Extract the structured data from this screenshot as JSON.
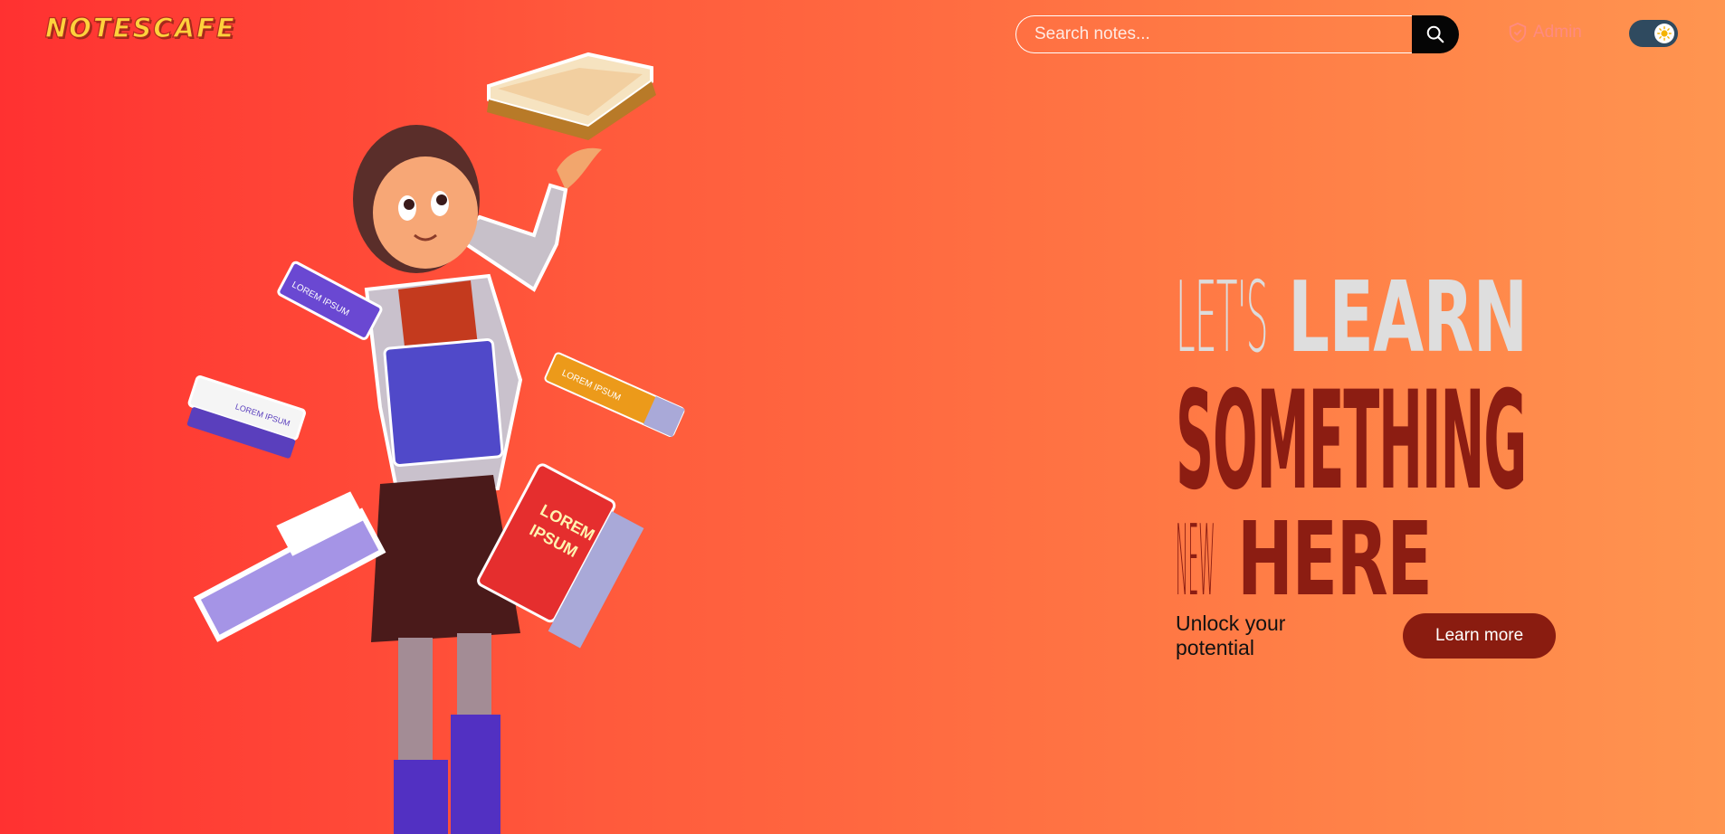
{
  "header": {
    "logo": "NOTESCAFE",
    "search": {
      "placeholder": "Search notes...",
      "button_icon": "search-icon"
    },
    "admin_label": "Admin",
    "theme_toggle_icon": "sun-icon"
  },
  "hero": {
    "line1_thin": "LET'S",
    "line1_bold": "LEARN",
    "line2": "SOMETHING",
    "line3_thin": "NEW",
    "line3_bold": "HERE",
    "tagline": "Unlock your potential",
    "cta_label": "Learn more"
  },
  "illustration": {
    "book_label_1": "LOREM IPSUM",
    "book_label_2": "LOREM IPSUM",
    "book_label_3": "LOREM IPSUM",
    "book_label_4": "LOREM",
    "book_label_5": "IPSUM"
  },
  "colors": {
    "gradient_start": "#ff3131",
    "gradient_end": "#ff9550",
    "accent_dark": "#8a1c10",
    "logo": "#ffd23c"
  }
}
